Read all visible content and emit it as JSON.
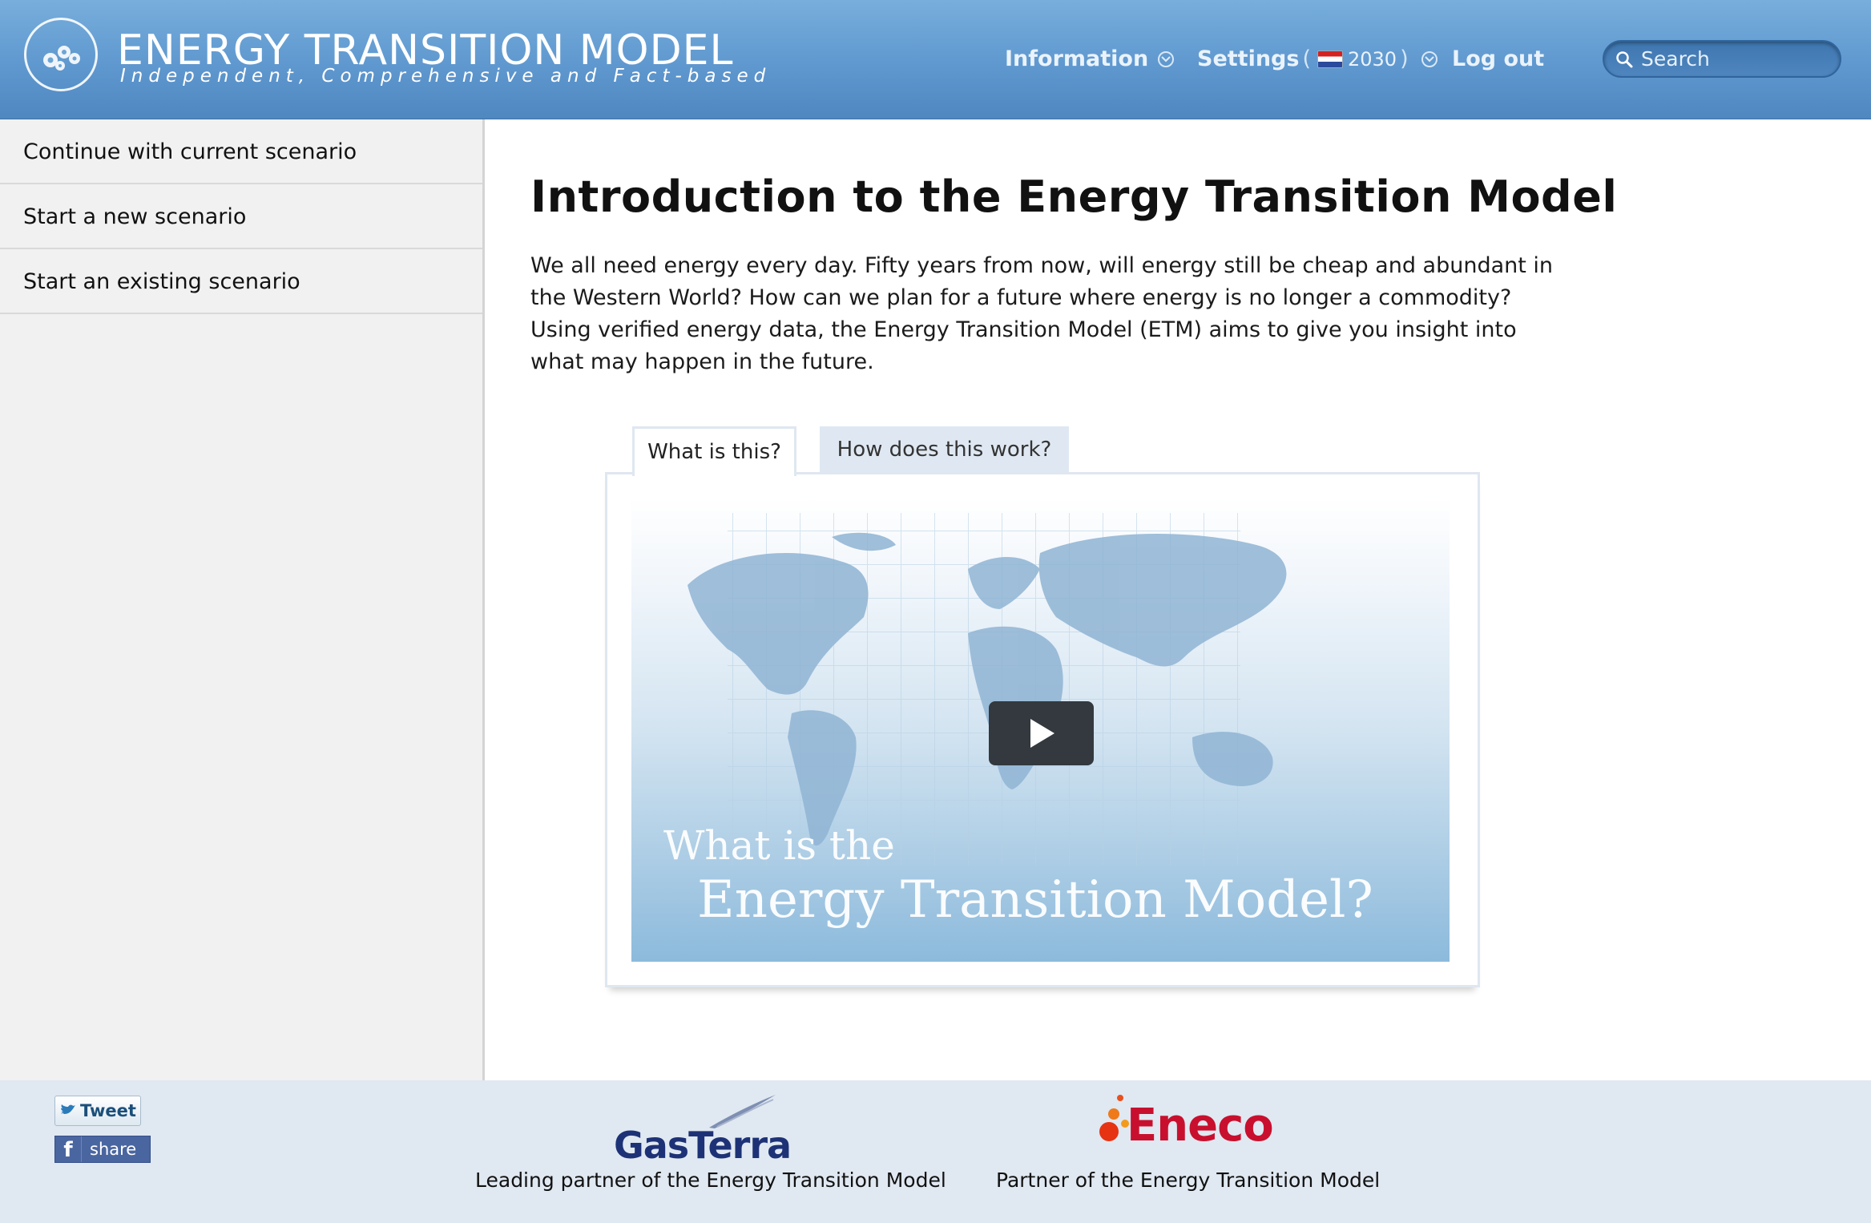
{
  "header": {
    "title": "ENERGY TRANSITION MODEL",
    "subtitle": "Independent, Comprehensive and Fact-based",
    "nav": {
      "information": "Information",
      "settings": "Settings",
      "settings_open_paren": "(",
      "settings_year": "2030",
      "settings_close_paren": ")",
      "logout": "Log out"
    },
    "search_placeholder": "Search",
    "flag_icon": "netherlands-flag-icon",
    "accent_color": "#5f98cf"
  },
  "sidebar": {
    "items": [
      {
        "label": "Continue with current scenario"
      },
      {
        "label": "Start a new scenario"
      },
      {
        "label": "Start an existing scenario"
      }
    ]
  },
  "main": {
    "title": "Introduction to the Energy Transition Model",
    "intro": "We all need energy every day. Fifty years from now, will energy still be cheap and abundant in the Western World? How can we plan for a future where energy is no longer a commodity? Using verified energy data, the Energy Transition Model (ETM) aims to give you insight into what may happen in the future.",
    "tabs": [
      {
        "label": "What is this?",
        "active": true
      },
      {
        "label": "How does this work?",
        "active": false
      }
    ],
    "video": {
      "line1": "What is the",
      "line2": "Energy Transition Model?"
    }
  },
  "footer": {
    "tweet_label": "Tweet",
    "share_label": "share",
    "partners": [
      {
        "logo_text": "GasTerra",
        "caption": "Leading partner of the Energy Transition Model"
      },
      {
        "logo_text": "Eneco",
        "caption": "Partner of the Energy Transition Model"
      }
    ]
  }
}
